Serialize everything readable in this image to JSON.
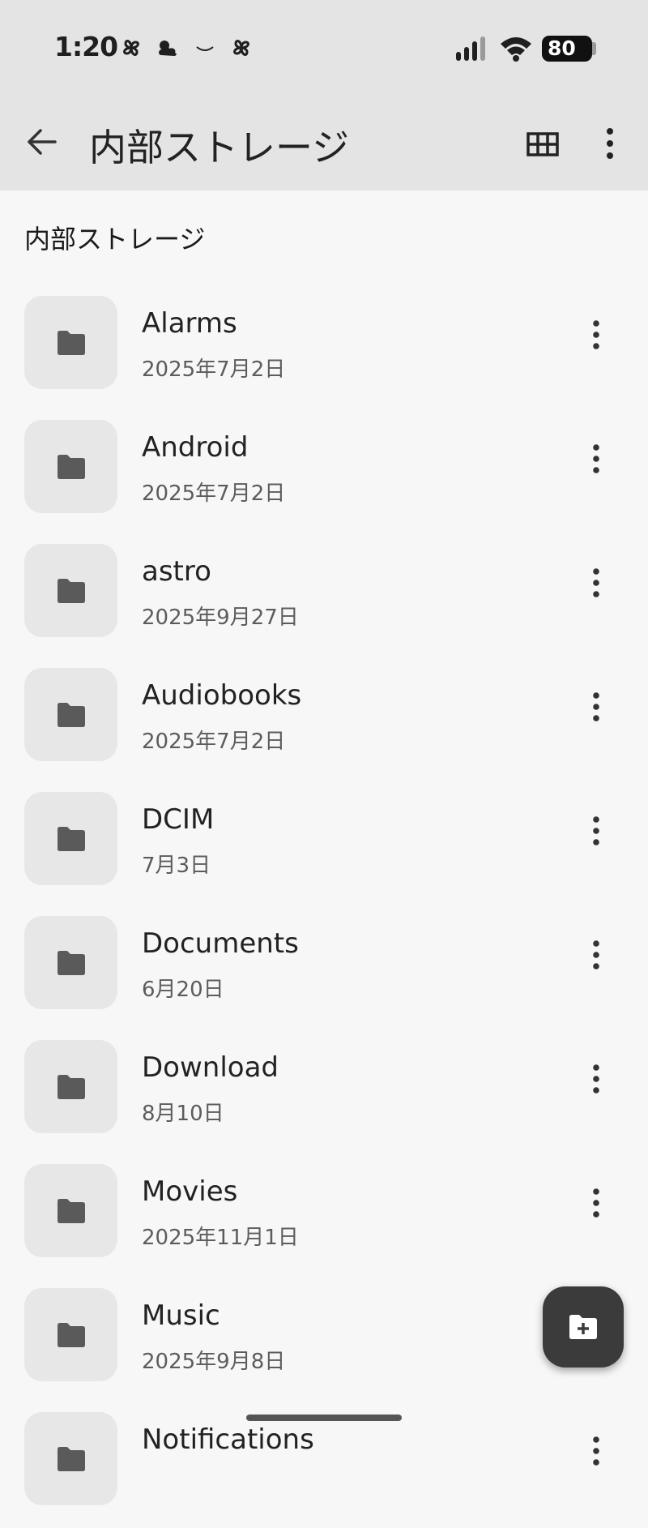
{
  "status_bar": {
    "time": "1:20",
    "battery": "80",
    "icons": [
      "pinwheel-icon",
      "cloud-icon",
      "smile-icon",
      "pinwheel-icon",
      "signal-icon",
      "wifi-icon",
      "battery-icon"
    ]
  },
  "app_bar": {
    "title": "内部ストレージ",
    "icons": [
      "back-arrow-icon",
      "grid-view-icon",
      "more-vert-icon"
    ]
  },
  "breadcrumb": "内部ストレージ",
  "folders": [
    {
      "name": "Alarms",
      "date": "2025年7月2日"
    },
    {
      "name": "Android",
      "date": "2025年7月2日"
    },
    {
      "name": "astro",
      "date": "2025年9月27日"
    },
    {
      "name": "Audiobooks",
      "date": "2025年7月2日"
    },
    {
      "name": "DCIM",
      "date": "7月3日"
    },
    {
      "name": "Documents",
      "date": "6月20日"
    },
    {
      "name": "Download",
      "date": "8月10日"
    },
    {
      "name": "Movies",
      "date": "2025年11月1日"
    },
    {
      "name": "Music",
      "date": "2025年9月8日"
    },
    {
      "name": "Notifications",
      "date": ""
    }
  ],
  "fab": {
    "icon": "create-folder-icon"
  }
}
